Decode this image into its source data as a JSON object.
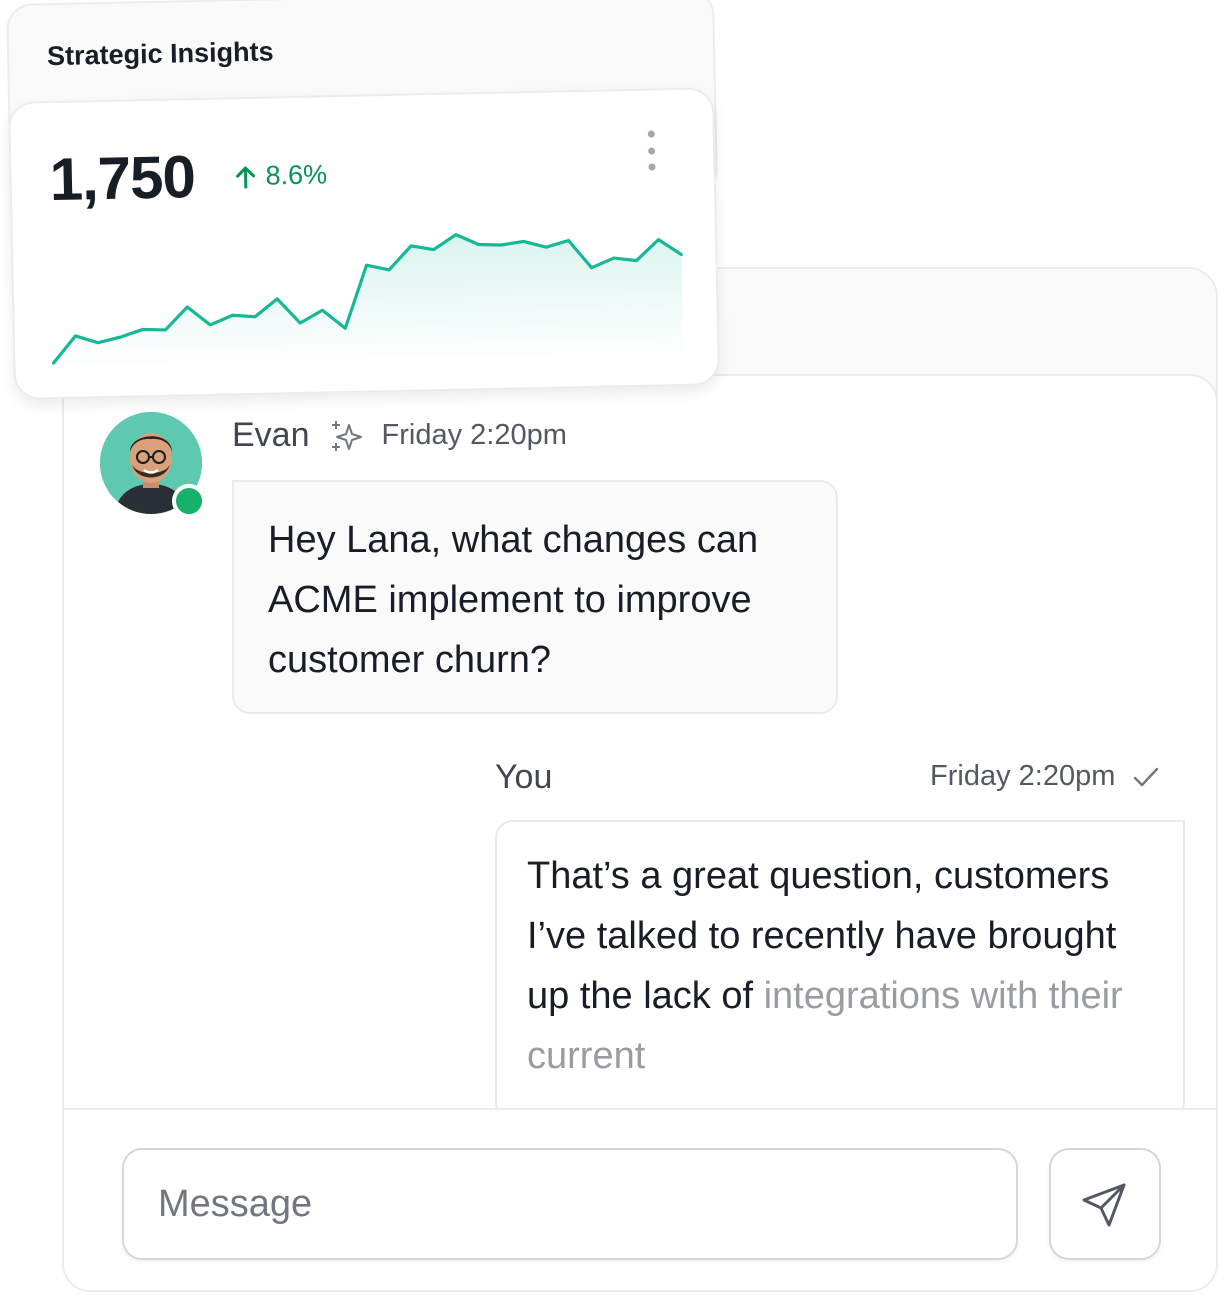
{
  "insights": {
    "title": "Strategic Insights",
    "value": "1,750",
    "change": "8.6%",
    "change_direction": "up",
    "change_color": "#079455",
    "line_color": "#17b897",
    "menu_icon": "kebab-menu-icon",
    "trend": [
      0,
      26,
      19,
      24,
      31,
      30,
      52,
      34,
      43,
      41,
      58,
      34,
      46,
      28,
      89,
      84,
      107,
      103,
      117,
      107,
      106,
      109,
      103,
      109,
      82,
      91,
      88,
      108,
      93
    ]
  },
  "chat": {
    "incoming": {
      "sender": "Evan",
      "time": "Friday 2:20pm",
      "status": "online",
      "status_color": "#17b26a",
      "badge_icon": "sparkle-icon",
      "text": "Hey Lana, what changes can ACME implement to improve customer churn?"
    },
    "outgoing": {
      "sender": "You",
      "time": "Friday 2:20pm",
      "read_icon": "check-icon",
      "text_visible": "That’s a great question, customers I’ve talked to recently have brought up the lack of",
      "text_faded": "integrations with their current"
    },
    "composer": {
      "placeholder": "Message",
      "send_icon": "send-icon"
    }
  }
}
